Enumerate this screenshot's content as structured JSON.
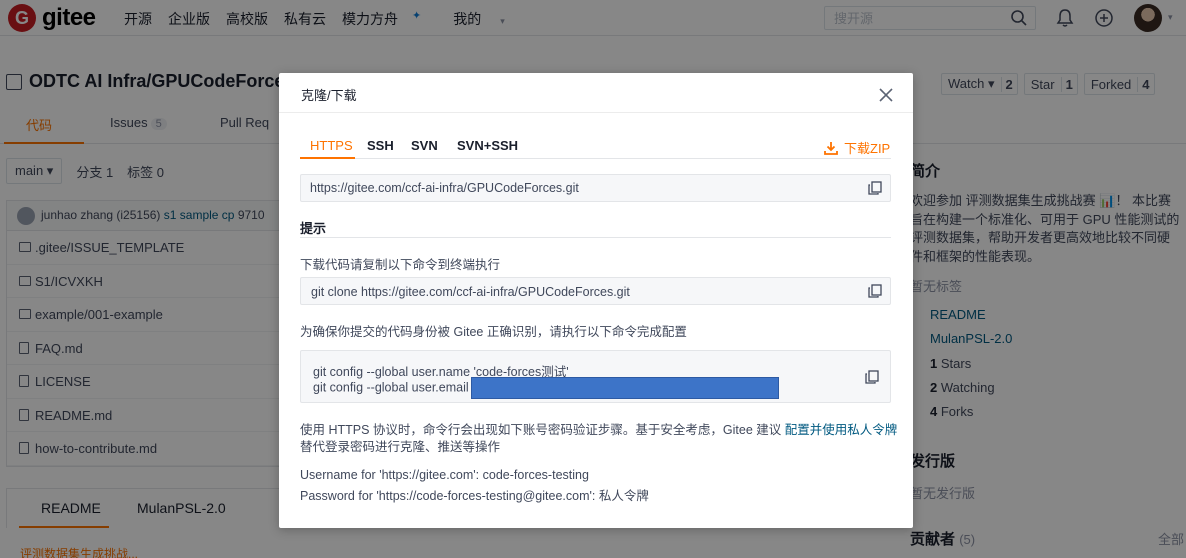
{
  "navbar": {
    "logo_mark": "G",
    "logo_text": "gitee",
    "links": [
      {
        "label": "开源"
      },
      {
        "label": "企业版"
      },
      {
        "label": "高校版"
      },
      {
        "label": "私有云"
      },
      {
        "label": "模力方舟",
        "star": "✦"
      },
      {
        "label": "我的",
        "caret": "▾"
      }
    ],
    "search_placeholder": "搜开源",
    "avatar_caret": "▾"
  },
  "repo": {
    "title": "ODTC AI Infra/GPUCodeForces",
    "actions": [
      {
        "label": "Watch ▾",
        "count": "2"
      },
      {
        "label": "Star",
        "count": "1"
      },
      {
        "label": "Forked",
        "count": "4"
      }
    ],
    "tabs": [
      {
        "label": "代码"
      },
      {
        "label": "Issues",
        "badge": "5"
      },
      {
        "label": "Pull Req"
      }
    ]
  },
  "files": {
    "branch": "main ▾",
    "branch_count": "分支 1",
    "tag_count": "标签 0",
    "commit_author": "junhao zhang (i25156)",
    "commit_message": "s1 sample cp",
    "commit_hash": "9710",
    "rows": [
      {
        "name": ".gitee/ISSUE_TEMPLATE",
        "kind": "folder"
      },
      {
        "name": "S1/ICVXKH",
        "kind": "folder"
      },
      {
        "name": "example/001-example",
        "kind": "folder"
      },
      {
        "name": "FAQ.md",
        "kind": "file"
      },
      {
        "name": "LICENSE",
        "kind": "file"
      },
      {
        "name": "README.md",
        "kind": "file"
      },
      {
        "name": "how-to-contribute.md",
        "kind": "file"
      }
    ],
    "readme_tab": "README",
    "license_tab": "MulanPSL-2.0",
    "readme_preview": "评测数据集生成挑战..."
  },
  "sidebar": {
    "intro_title": "简介",
    "intro_text": "欢迎参加 评测数据集生成挑战赛 📊！ 本比赛旨在构建一个标准化、可用于 GPU 性能测试的评测数据集，帮助开发者更高效地比较不同硬件和框架的性能表现。",
    "no_tags": "暂无标签",
    "readme_link": "README",
    "license_link": "MulanPSL-2.0",
    "stars": "1",
    "stars_label": "Stars",
    "watching": "2",
    "watching_label": "Watching",
    "forks": "4",
    "forks_label": "Forks",
    "release_title": "发行版",
    "no_release": "暂无发行版",
    "contrib_title": "贡献者",
    "contrib_count": "(5)",
    "contrib_all": "全部"
  },
  "modal": {
    "title": "克隆/下载",
    "tabs": [
      "HTTPS",
      "SSH",
      "SVN",
      "SVN+SSH"
    ],
    "download_zip": "下载ZIP",
    "clone_url": "https://gitee.com/ccf-ai-infra/GPUCodeForces.git",
    "hint_title": "提示",
    "hint_copy_cmd": "下载代码请复制以下命令到终端执行",
    "clone_cmd": "git clone https://gitee.com/ccf-ai-infra/GPUCodeForces.git",
    "identity_hint": "为确保你提交的代码身份被 Gitee 正确识别，请执行以下命令完成配置",
    "config_name": "git config --global user.name 'code-forces测试'",
    "config_email": "git config --global user.email",
    "https_note_1": "使用 HTTPS 协议时，命令行会出现如下账号密码验证步骤。基于安全考虑，Gitee 建议",
    "https_note_link": "配置并使用私人令牌",
    "https_note_2": "替代登录密码进行克隆、推送等操作",
    "username_line": "Username for 'https://gitee.com': code-forces-testing",
    "password_line": "Password for 'https://code-forces-testing@gitee.com': 私人令牌"
  }
}
